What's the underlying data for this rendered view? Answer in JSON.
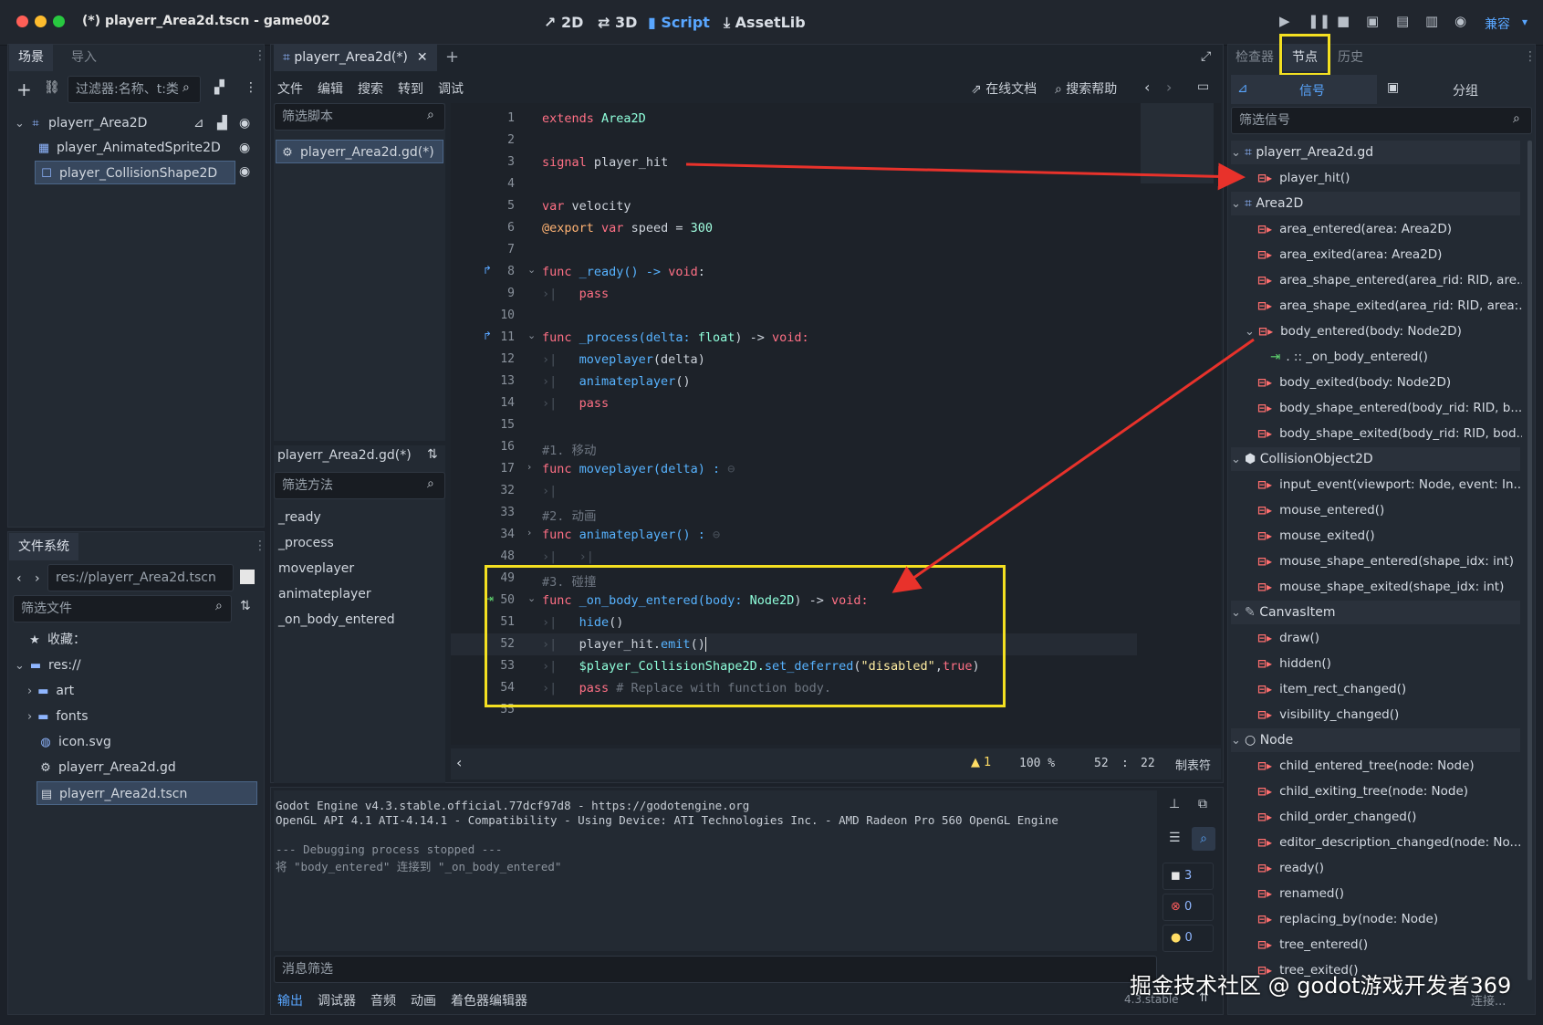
{
  "window": {
    "title": "(*) playerr_Area2d.tscn - game002"
  },
  "main_buttons": [
    "2D",
    "3D",
    "Script",
    "AssetLib"
  ],
  "top_right_label": "兼容",
  "scene_dock": {
    "tabs": [
      "场景",
      "导入"
    ],
    "filter_placeholder": "过滤器:名称、t:类",
    "tree": [
      "playerr_Area2D",
      "player_AnimatedSprite2D",
      "player_CollisionShape2D"
    ]
  },
  "filesystem_dock": {
    "tab": "文件系统",
    "path": "res://playerr_Area2d.tscn",
    "filter_placeholder": "筛选文件",
    "tree": [
      "收藏：",
      "res://",
      "art",
      "fonts",
      "icon.svg",
      "playerr_Area2d.gd",
      "playerr_Area2d.tscn"
    ]
  },
  "editor": {
    "tab_label": "playerr_Area2d(*)",
    "menu": [
      "文件",
      "编辑",
      "搜索",
      "转到",
      "调试"
    ],
    "online_docs": "在线文档",
    "search_help": "搜索帮助",
    "script_filter": "筛选脚本",
    "script_item": "playerr_Area2d.gd(*)",
    "methods_header": "playerr_Area2d.gd(*)",
    "method_filter": "筛选方法",
    "methods": [
      "_ready",
      "_process",
      "moveplayer",
      "animateplayer",
      "_on_body_entered"
    ],
    "line_numbers": [
      "1",
      "2",
      "3",
      "4",
      "5",
      "6",
      "7",
      "8",
      "9",
      "10",
      "11",
      "12",
      "13",
      "14",
      "15",
      "16",
      "17",
      "32",
      "33",
      "34",
      "48",
      "49",
      "50",
      "51",
      "52",
      "53",
      "54",
      "55"
    ],
    "status": {
      "warnings": "1",
      "zoom": "100 %",
      "line": "52",
      "col": "22",
      "indent": "制表符"
    }
  },
  "code": {
    "l1a": "extends",
    "l1b": "Area2D",
    "l3a": "signal",
    "l3b": "player_hit",
    "l5a": "var",
    "l5b": "velocity",
    "l6a": "@export",
    "l6b": "var",
    "l6c": "speed =",
    "l6d": "300",
    "l8a": "func",
    "l8b": "_ready() ->",
    "l8c": "void",
    ":": ":",
    "l9": "pass",
    "l11a": "func",
    "l11b": "_process(delta:",
    "l11c": "float",
    ") ->": ") ->",
    "l11d": "void:",
    "l12": "moveplayer",
    "l12b": "(delta)",
    "l13": "animateplayer",
    "l13b": "()",
    "l14": "pass",
    "l16": "#1. 移动",
    "l17a": "func",
    "l17b": "moveplayer(delta) :",
    "l33": "#2. 动画",
    "l34a": "func",
    "l34b": "animateplayer() :",
    "l49": "#3. 碰撞",
    "l50a": "func",
    "l50b": "_on_body_entered(body:",
    "l50c": "Node2D",
    "l50d": ") ->",
    "l50e": "void:",
    "l51": "hide",
    "l51b": "()",
    "l52a": "player_hit.",
    "l52b": "emit",
    "l52c": "()",
    "l53a": "$player_CollisionShape2D.",
    "l53b": "set_deferred",
    "l53c": "(",
    "l53d": "\"disabled\"",
    "l53e": ",",
    "l53f": "true",
    ")": ")",
    "l54a": "pass",
    "l54b": "# Replace with function body."
  },
  "console": {
    "lines": [
      "Godot Engine v4.3.stable.official.77dcf97d8 - https://godotengine.org",
      "OpenGL API 4.1 ATI-4.14.1 - Compatibility - Using Device: ATI Technologies Inc. - AMD Radeon Pro 560 OpenGL Engine",
      "",
      "--- Debugging process stopped ---",
      "将 \"body_entered\" 连接到 \"_on_body_entered\""
    ],
    "filter_placeholder": "消息筛选",
    "counts": [
      "3",
      "0",
      "0"
    ],
    "bottom_tabs": [
      "输出",
      "调试器",
      "音频",
      "动画",
      "着色器编辑器"
    ],
    "version": "4.3.stable"
  },
  "node_dock": {
    "tabs": [
      "检查器",
      "节点",
      "历史"
    ],
    "subtabs": [
      "信号",
      "分组"
    ],
    "filter_placeholder": "筛选信号",
    "sections": {
      "s1": "playerr_Area2d.gd",
      "s2": "Area2D",
      "s3": "CollisionObject2D",
      "s4": "CanvasItem",
      "s5": "Node"
    },
    "signals": {
      "player_hit": "player_hit()",
      "area_entered": "area_entered(area: Area2D)",
      "area_exited": "area_exited(area: Area2D)",
      "area_shape_entered": "area_shape_entered(area_rid: RID, are...",
      "area_shape_exited": "area_shape_exited(area_rid: RID, area:...",
      "body_entered": "body_entered(body: Node2D)",
      "connection": ". :: _on_body_entered()",
      "body_exited": "body_exited(body: Node2D)",
      "body_shape_entered": "body_shape_entered(body_rid: RID, b...",
      "body_shape_exited": "body_shape_exited(body_rid: RID, bod...",
      "input_event": "input_event(viewport: Node, event: In...",
      "mouse_entered": "mouse_entered()",
      "mouse_exited": "mouse_exited()",
      "mouse_shape_entered": "mouse_shape_entered(shape_idx: int)",
      "mouse_shape_exited": "mouse_shape_exited(shape_idx: int)",
      "draw": "draw()",
      "hidden": "hidden()",
      "item_rect_changed": "item_rect_changed()",
      "visibility_changed": "visibility_changed()",
      "child_entered_tree": "child_entered_tree(node: Node)",
      "child_exiting_tree": "child_exiting_tree(node: Node)",
      "child_order_changed": "child_order_changed()",
      "editor_description_changed": "editor_description_changed(node: No...",
      "ready": "ready()",
      "renamed": "renamed()",
      "replacing_by": "replacing_by(node: Node)",
      "tree_entered": "tree_entered()",
      "tree_exited": "tree_exited()"
    },
    "connect_button": "连接..."
  },
  "watermark": "掘金技术社区 @ godot游戏开发者369",
  "colors": {
    "accent": "#59a6ff",
    "highlight_box": "#f4e021",
    "arrow": "#e8322b"
  }
}
